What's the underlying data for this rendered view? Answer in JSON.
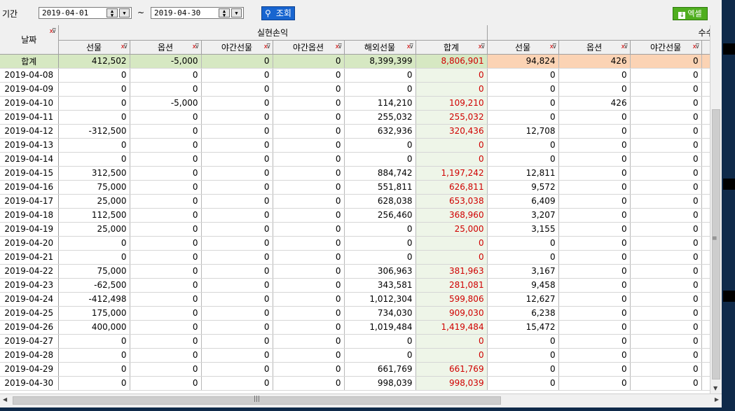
{
  "toolbar": {
    "period_label": "기간",
    "start_date": "2019-04-01",
    "tilde": "~",
    "end_date": "2019-04-30",
    "query_label": "조회",
    "excel_label": "엑셀"
  },
  "header": {
    "date_col": "날짜",
    "realized_group": "실현손익",
    "fee_group": "수수료",
    "realized_cols": [
      "선물",
      "옵션",
      "야간선물",
      "야간옵션",
      "해외선물",
      "합계"
    ],
    "fee_cols": [
      "선물",
      "옵션",
      "야간선물"
    ]
  },
  "total_row": {
    "label": "합계",
    "values": [
      "412,502",
      "-5,000",
      "0",
      "0",
      "8,399,399",
      "8,806,901",
      "94,824",
      "426",
      "0"
    ]
  },
  "rows": [
    {
      "date": "2019-04-08",
      "values": [
        "0",
        "0",
        "0",
        "0",
        "0",
        "0",
        "0",
        "0",
        "0"
      ]
    },
    {
      "date": "2019-04-09",
      "values": [
        "0",
        "0",
        "0",
        "0",
        "0",
        "0",
        "0",
        "0",
        "0"
      ]
    },
    {
      "date": "2019-04-10",
      "values": [
        "0",
        "-5,000",
        "0",
        "0",
        "114,210",
        "109,210",
        "0",
        "426",
        "0"
      ]
    },
    {
      "date": "2019-04-11",
      "values": [
        "0",
        "0",
        "0",
        "0",
        "255,032",
        "255,032",
        "0",
        "0",
        "0"
      ]
    },
    {
      "date": "2019-04-12",
      "values": [
        "-312,500",
        "0",
        "0",
        "0",
        "632,936",
        "320,436",
        "12,708",
        "0",
        "0"
      ]
    },
    {
      "date": "2019-04-13",
      "values": [
        "0",
        "0",
        "0",
        "0",
        "0",
        "0",
        "0",
        "0",
        "0"
      ]
    },
    {
      "date": "2019-04-14",
      "values": [
        "0",
        "0",
        "0",
        "0",
        "0",
        "0",
        "0",
        "0",
        "0"
      ]
    },
    {
      "date": "2019-04-15",
      "values": [
        "312,500",
        "0",
        "0",
        "0",
        "884,742",
        "1,197,242",
        "12,811",
        "0",
        "0"
      ]
    },
    {
      "date": "2019-04-16",
      "values": [
        "75,000",
        "0",
        "0",
        "0",
        "551,811",
        "626,811",
        "9,572",
        "0",
        "0"
      ]
    },
    {
      "date": "2019-04-17",
      "values": [
        "25,000",
        "0",
        "0",
        "0",
        "628,038",
        "653,038",
        "6,409",
        "0",
        "0"
      ]
    },
    {
      "date": "2019-04-18",
      "values": [
        "112,500",
        "0",
        "0",
        "0",
        "256,460",
        "368,960",
        "3,207",
        "0",
        "0"
      ]
    },
    {
      "date": "2019-04-19",
      "values": [
        "25,000",
        "0",
        "0",
        "0",
        "0",
        "25,000",
        "3,155",
        "0",
        "0"
      ]
    },
    {
      "date": "2019-04-20",
      "values": [
        "0",
        "0",
        "0",
        "0",
        "0",
        "0",
        "0",
        "0",
        "0"
      ]
    },
    {
      "date": "2019-04-21",
      "values": [
        "0",
        "0",
        "0",
        "0",
        "0",
        "0",
        "0",
        "0",
        "0"
      ]
    },
    {
      "date": "2019-04-22",
      "values": [
        "75,000",
        "0",
        "0",
        "0",
        "306,963",
        "381,963",
        "3,167",
        "0",
        "0"
      ]
    },
    {
      "date": "2019-04-23",
      "values": [
        "-62,500",
        "0",
        "0",
        "0",
        "343,581",
        "281,081",
        "9,458",
        "0",
        "0"
      ]
    },
    {
      "date": "2019-04-24",
      "values": [
        "-412,498",
        "0",
        "0",
        "0",
        "1,012,304",
        "599,806",
        "12,627",
        "0",
        "0"
      ]
    },
    {
      "date": "2019-04-25",
      "values": [
        "175,000",
        "0",
        "0",
        "0",
        "734,030",
        "909,030",
        "6,238",
        "0",
        "0"
      ]
    },
    {
      "date": "2019-04-26",
      "values": [
        "400,000",
        "0",
        "0",
        "0",
        "1,019,484",
        "1,419,484",
        "15,472",
        "0",
        "0"
      ]
    },
    {
      "date": "2019-04-27",
      "values": [
        "0",
        "0",
        "0",
        "0",
        "0",
        "0",
        "0",
        "0",
        "0"
      ]
    },
    {
      "date": "2019-04-28",
      "values": [
        "0",
        "0",
        "0",
        "0",
        "0",
        "0",
        "0",
        "0",
        "0"
      ]
    },
    {
      "date": "2019-04-29",
      "values": [
        "0",
        "0",
        "0",
        "0",
        "661,769",
        "661,769",
        "0",
        "0",
        "0"
      ]
    },
    {
      "date": "2019-04-30",
      "values": [
        "0",
        "0",
        "0",
        "0",
        "998,039",
        "998,039",
        "0",
        "0",
        "0"
      ]
    }
  ]
}
